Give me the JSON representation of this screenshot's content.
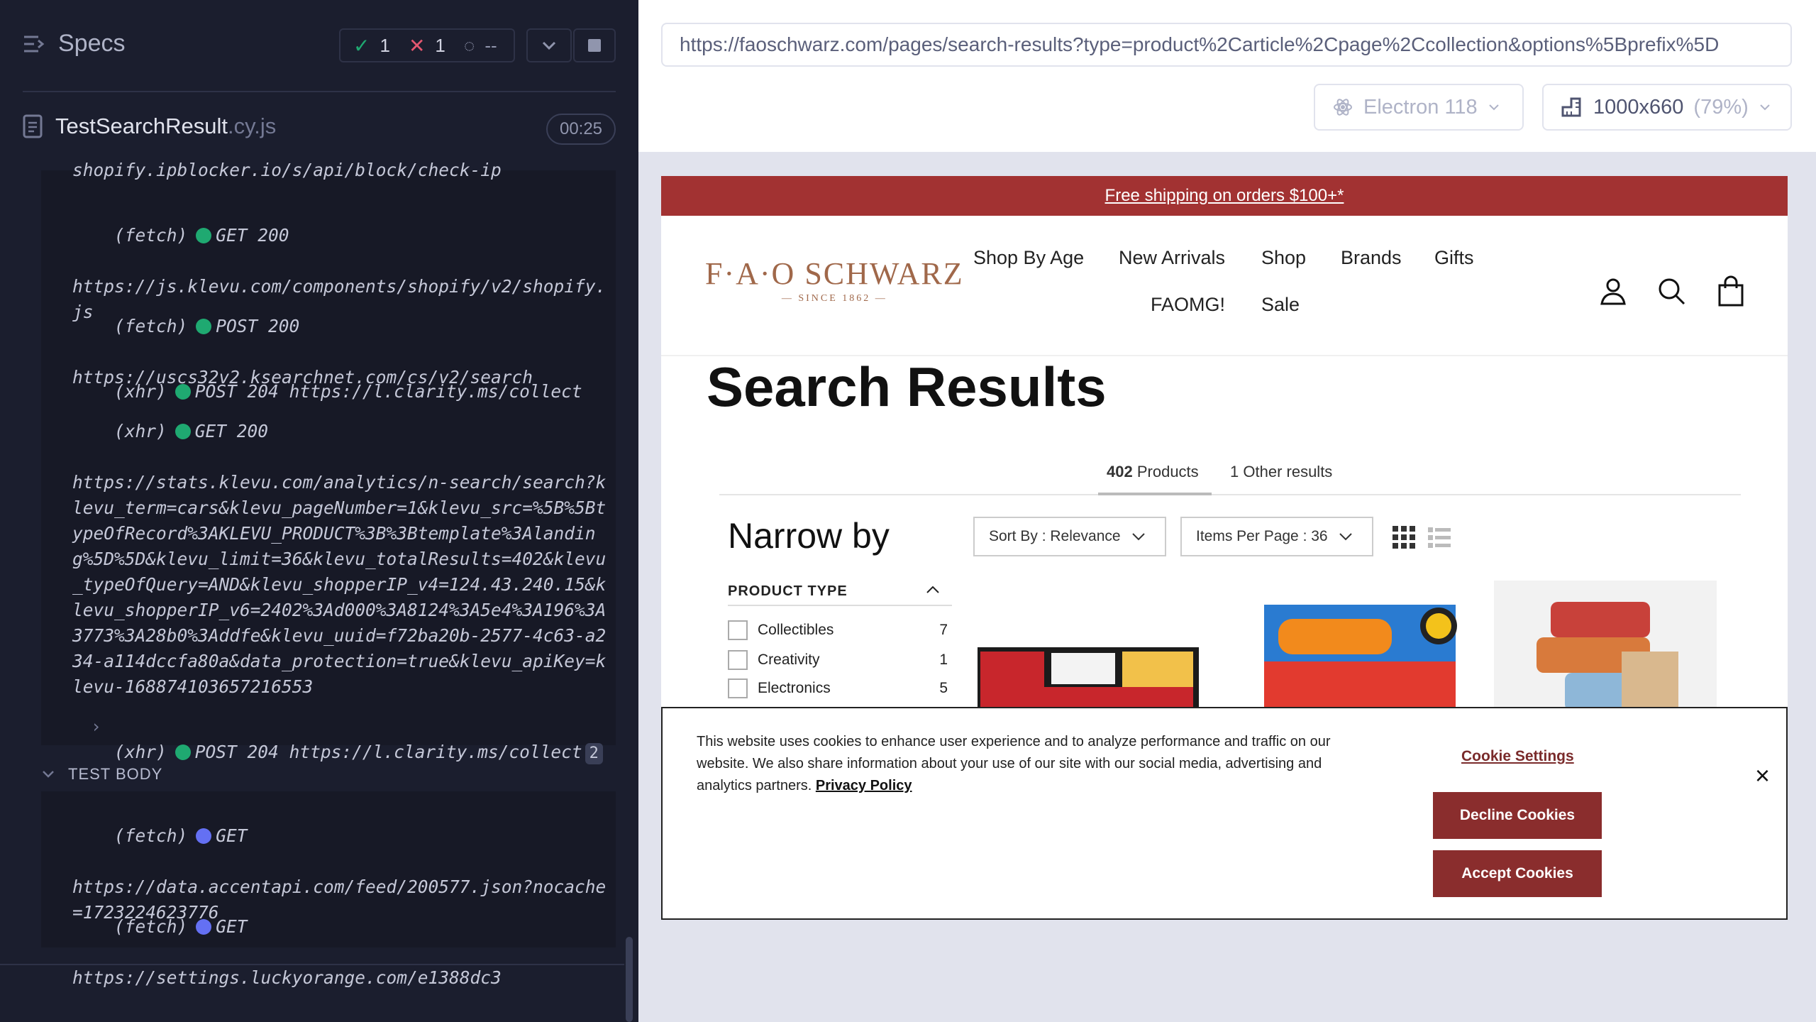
{
  "runner": {
    "header_title": "Specs",
    "stats": {
      "passed": "1",
      "failed": "1",
      "pending": "--"
    },
    "spec_name": "TestSearchResult",
    "spec_ext": ".cy.js",
    "duration": "00:25",
    "log_entries": [
      {
        "text": "shopify.ipblocker.io/s/api/block/check-ip"
      },
      {
        "kind": "(fetch)",
        "method": "GET 200",
        "url": "https://js.klevu.com/components/shopify/v2/shopify.js"
      },
      {
        "kind": "(fetch)",
        "method": "POST 200",
        "url": "https://uscs32v2.ksearchnet.com/cs/v2/search"
      },
      {
        "kind": "(xhr)",
        "method": "POST 204",
        "url": "https://l.clarity.ms/collect"
      },
      {
        "kind": "(xhr)",
        "method": "GET 200",
        "url": "https://stats.klevu.com/analytics/n-search/search?klevu_term=cars&klevu_pageNumber=1&klevu_src=%5B%5BtypeOfRecord%3AKLEVU_PRODUCT%3B%3Btemplate%3Alanding%5D%5D&klevu_limit=36&klevu_totalResults=402&klevu_typeOfQuery=AND&klevu_shopperIP_v4=124.43.240.15&klevu_shopperIP_v6=2402%3Ad000%3A8124%3A5e4%3A196%3A3773%3A28b0%3Addfe&klevu_uuid=f72ba20b-2577-4c63-a234-a114dccfa80a&data_protection=true&klevu_apiKey=klevu-168874103657216553"
      },
      {
        "kind": "(xhr)",
        "method": "POST 204",
        "url": "https://l.clarity.ms/collect",
        "count": "2"
      }
    ],
    "test_body_label": "TEST BODY",
    "test_body_entries": [
      {
        "kind": "(fetch)",
        "method": "GET",
        "url": "https://data.accentapi.com/feed/200577.json?nocache=1723224623776"
      },
      {
        "kind": "(fetch)",
        "method": "GET",
        "url": "https://settings.luckyorange.com/e1388dc3"
      }
    ]
  },
  "browser": {
    "url": "https://faoschwarz.com/pages/search-results?type=product%2Carticle%2Cpage%2Ccollection&options%5Bprefix%5D",
    "engine": "Electron 118",
    "viewport": "1000x660",
    "zoom": "(79%)"
  },
  "site": {
    "promo": "Free shipping on orders $100+*",
    "logo_main": "F·A·O SCHWARZ",
    "logo_sub": "— SINCE 1862 —",
    "nav": [
      "Shop By Age",
      "New Arrivals",
      "Shop",
      "Brands",
      "Gifts",
      "FAOMG!",
      "Sale"
    ],
    "page_title": "Search Results",
    "tab_products_count": "402",
    "tab_products_label": "Products",
    "tab_other_count": "1",
    "tab_other_label": "Other results",
    "narrow_by": "Narrow by",
    "product_type_label": "PRODUCT TYPE",
    "filters": [
      {
        "label": "Collectibles",
        "count": "7"
      },
      {
        "label": "Creativity",
        "count": "1"
      },
      {
        "label": "Electronics",
        "count": "5"
      }
    ],
    "sort_label": "Sort By : Relevance",
    "items_per_page_label": "Items Per Page : 36"
  },
  "cookie": {
    "text": "This website uses cookies to enhance user experience and to analyze performance and traffic on our website. We also share information about your use of our site with our social media, advertising and analytics partners.",
    "privacy_link": "Privacy Policy",
    "settings_link": "Cookie Settings",
    "decline": "Decline Cookies",
    "accept": "Accept Cookies",
    "close": "×"
  },
  "colors": {
    "runner_bg": "#1b1e2e",
    "pass": "#1fa971",
    "fail": "#e45770",
    "brand_red": "#a23232"
  }
}
